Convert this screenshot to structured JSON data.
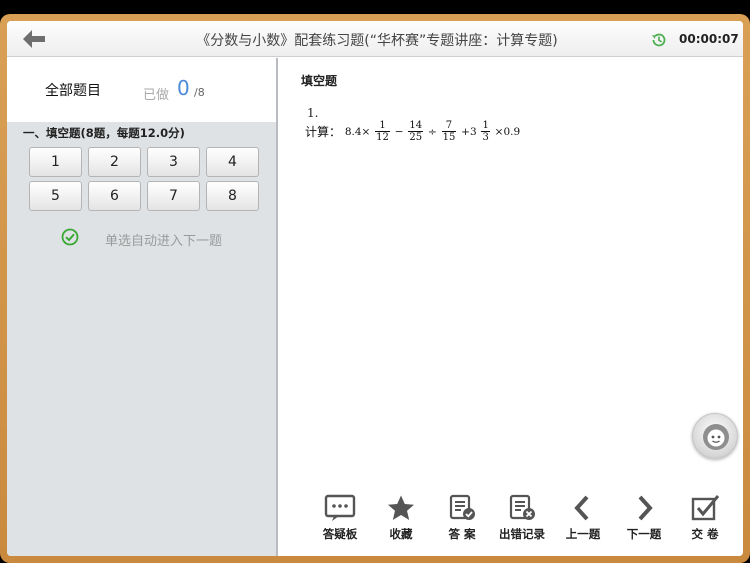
{
  "header": {
    "title": "《分数与小数》配套练习题(“华杯赛”专题讲座：计算专题)",
    "timer": "00:00:07",
    "accent": "#4caf50"
  },
  "sidebar": {
    "all_label": "全部题目",
    "done_label": "已做",
    "done_count": "0",
    "done_total": "/8",
    "section_title": "一、填空题(8题，每题12.0分)",
    "questions": [
      "1",
      "2",
      "3",
      "4",
      "5",
      "6",
      "7",
      "8"
    ],
    "auto_next_label": "单选自动进入下一题"
  },
  "question": {
    "type_label": "填空题",
    "number": "1.",
    "prompt": "计算：",
    "expr": {
      "a": "8.4×",
      "f1n": "1",
      "f1d": "12",
      "op1": "−",
      "f2n": "14",
      "f2d": "25",
      "op2": "÷",
      "f3n": "7",
      "f3d": "15",
      "op3": "+3",
      "f4n": "1",
      "f4d": "3",
      "tail": "×0.9"
    }
  },
  "toolbar": {
    "qa": "答疑板",
    "favorite": "收藏",
    "answer": "答 案",
    "error_record": "出错记录",
    "prev": "上一题",
    "next": "下一题",
    "submit": "交 卷"
  }
}
